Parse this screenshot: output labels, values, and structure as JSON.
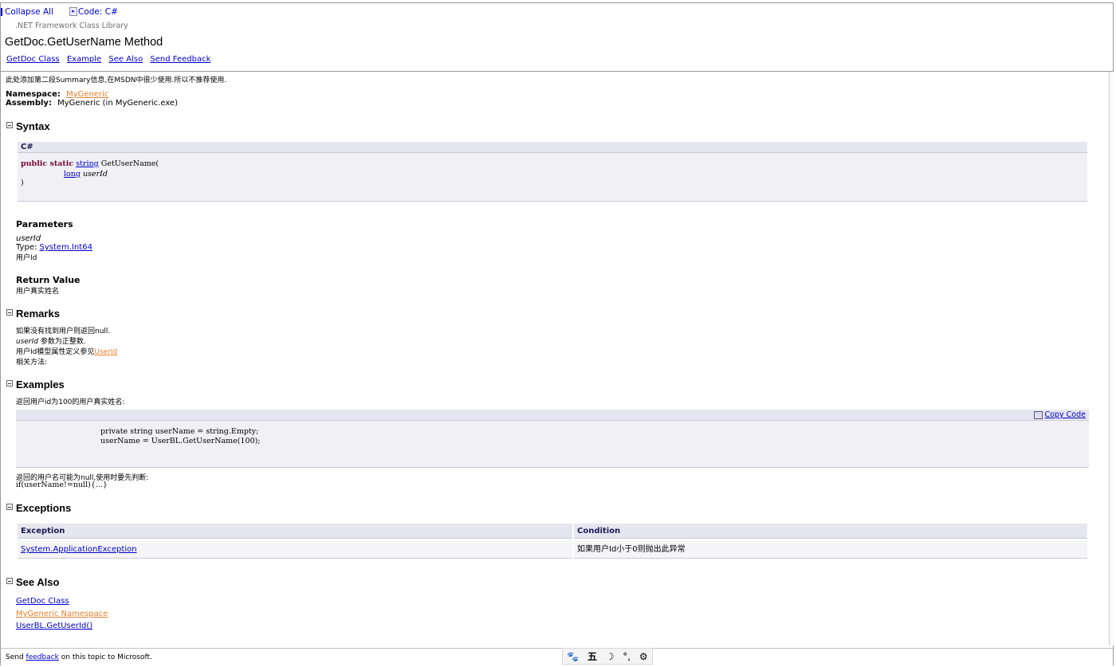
{
  "header": {
    "collapse_all": "Collapse All",
    "code_label": "Code: C#",
    "library": ".NET Framework Class Library",
    "title": "GetDoc.GetUserName Method",
    "links": [
      "GetDoc Class",
      "Example",
      "See Also",
      "Send Feedback"
    ]
  },
  "summary": "此处添加第二段Summary信息,在MSDN中很少使用.所以不推荐使用.",
  "namespace": {
    "label": "Namespace:",
    "value": "MyGeneric"
  },
  "assembly": {
    "label": "Assembly:",
    "value": "MyGeneric (in MyGeneric.exe)"
  },
  "syntax": {
    "heading": "Syntax",
    "lang": "C#",
    "line1_kw": "public static",
    "line1_type": "string",
    "line1_rest": "GetUserName(",
    "line2_type": "long",
    "line2_param": "userId",
    "line3": ")"
  },
  "parameters": {
    "heading": "Parameters",
    "name": "userId",
    "type_label": "Type:",
    "type_link": "System.Int64",
    "desc": "用户Id"
  },
  "return_value": {
    "heading": "Return Value",
    "desc": "用户真实姓名"
  },
  "remarks": {
    "heading": "Remarks",
    "line1": "如果没有找到用户则返回null.",
    "line2_param": "userId",
    "line2_rest": "参数为正整数.",
    "line3_text": "用户Id模型属性定义参见",
    "line3_link": "UserId",
    "line4": "相关方法:"
  },
  "examples": {
    "heading": "Examples",
    "intro": "返回用户id为100的用户真实姓名:",
    "copy_code": "Copy Code",
    "code_line1": "private string userName = string.Empty;",
    "code_line2": "userName = UserBL.GetUserName(100);",
    "note": "返回的用户名可能为null,使用时要先判断:",
    "note_code": "if(userName!=null){...}"
  },
  "exceptions": {
    "heading": "Exceptions",
    "col1": "Exception",
    "col2": "Condition",
    "row_exception": "System.ApplicationException",
    "row_condition": "如果用户Id小于0则抛出此异常"
  },
  "see_also": {
    "heading": "See Also",
    "links": [
      "GetDoc Class",
      "MyGeneric Namespace",
      "UserBL.GetUserId()"
    ]
  },
  "footer": {
    "send": "Send",
    "feedback": "feedback",
    "rest": "on this topic to Microsoft."
  },
  "ime": {
    "icons": [
      "paw-icon",
      "wu-icon",
      "moon-icon",
      "comma-icon",
      "gear-icon"
    ],
    "wu_char": "五"
  }
}
